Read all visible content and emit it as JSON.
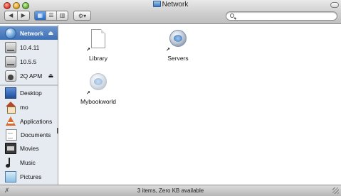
{
  "window": {
    "title": "Network"
  },
  "toolbar": {
    "back_label": "◀",
    "forward_label": "▶",
    "view_icon_label": "▦",
    "view_list_label": "☰",
    "view_column_label": "▥",
    "action_label": "⚙▾"
  },
  "search": {
    "value": "",
    "placeholder": ""
  },
  "sidebar": {
    "items": [
      {
        "label": "Network",
        "icon": "network-globe-icon",
        "selected": true,
        "eject": true
      },
      {
        "label": "10.4.11",
        "icon": "hard-disk-icon",
        "selected": false,
        "eject": false
      },
      {
        "label": "10.5.5",
        "icon": "hard-disk-icon",
        "selected": false,
        "eject": false
      },
      {
        "label": "2Q APM",
        "icon": "ipod-icon",
        "selected": false,
        "eject": true
      },
      {
        "label": "Desktop",
        "icon": "desktop-folder-icon",
        "selected": false,
        "eject": false
      },
      {
        "label": "mo",
        "icon": "home-icon",
        "selected": false,
        "eject": false
      },
      {
        "label": "Applications",
        "icon": "applications-icon",
        "selected": false,
        "eject": false
      },
      {
        "label": "Documents",
        "icon": "documents-icon",
        "selected": false,
        "eject": false
      },
      {
        "label": "Movies",
        "icon": "movies-icon",
        "selected": false,
        "eject": false
      },
      {
        "label": "Music",
        "icon": "music-icon",
        "selected": false,
        "eject": false
      },
      {
        "label": "Pictures",
        "icon": "pictures-icon",
        "selected": false,
        "eject": false
      }
    ],
    "eject_glyph": "⏏"
  },
  "content": {
    "items": [
      {
        "label": "Library",
        "icon": "alias-document-icon"
      },
      {
        "label": "Servers",
        "icon": "server-globe-icon"
      },
      {
        "label": "Mybookworld",
        "icon": "server-globe-icon"
      }
    ],
    "alias_glyph": "↗"
  },
  "status": {
    "text": "3 items, Zero KB available",
    "left_glyph": "✗"
  }
}
